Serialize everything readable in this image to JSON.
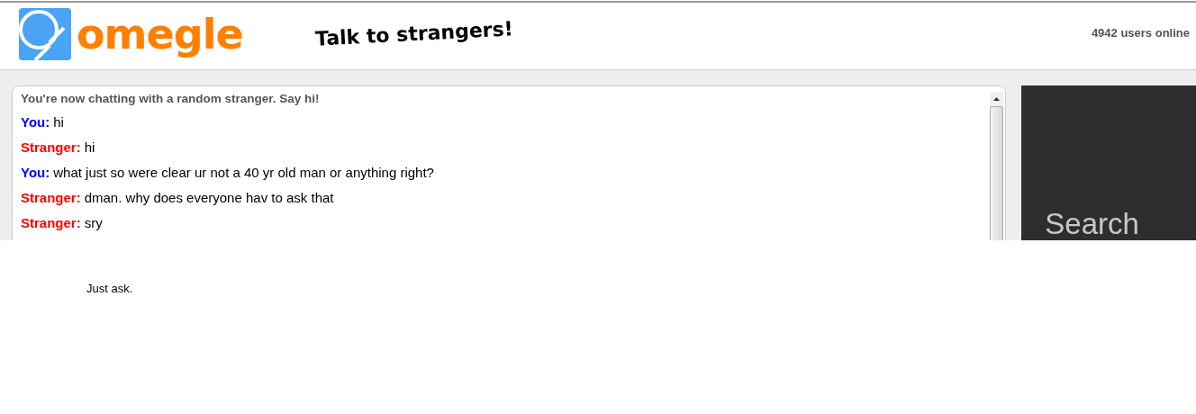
{
  "header": {
    "logo_text": "omegle",
    "tagline": "Talk to strangers!",
    "users_online": "4942 users online"
  },
  "chat": {
    "status": "You're now chatting with a random stranger. Say hi!",
    "messages": [
      {
        "kind": "you",
        "speaker": "You:",
        "text": "hi"
      },
      {
        "kind": "stranger",
        "speaker": "Stranger:",
        "text": "hi"
      },
      {
        "kind": "you",
        "speaker": "You:",
        "text": "what just so were clear ur not a 40 yr old man or anything right?"
      },
      {
        "kind": "stranger",
        "speaker": "Stranger:",
        "text": "dman. why does everyone hav to ask that"
      },
      {
        "kind": "stranger",
        "speaker": "Stranger:",
        "text": "sry"
      }
    ]
  },
  "side_panel": {
    "text": "Search"
  },
  "caption": "Just ask."
}
